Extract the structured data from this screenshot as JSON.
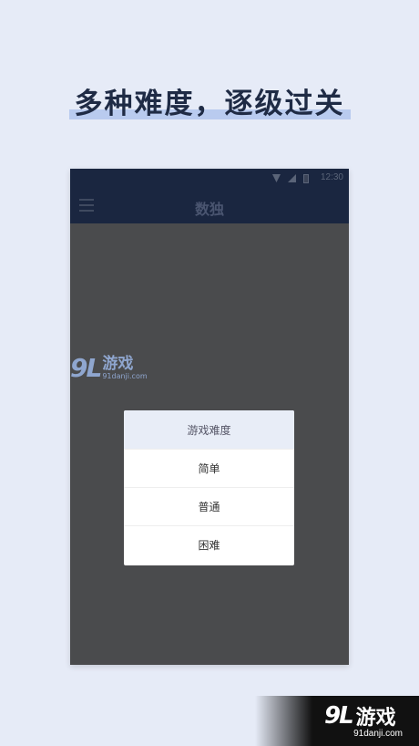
{
  "headline": "多种难度，逐级过关",
  "status_bar": {
    "time": "12:30"
  },
  "app_bar": {
    "title": "数独"
  },
  "dialog": {
    "title": "游戏难度",
    "options": [
      "简单",
      "普通",
      "困难"
    ]
  },
  "watermark": {
    "mark": "9L",
    "name": "游戏",
    "url": "91danji.com"
  },
  "corner_badge": {
    "mark": "9L",
    "name": "游戏",
    "url": "91danji.com"
  },
  "colors": {
    "background": "#e6ebf7",
    "headline_text": "#1f2b45",
    "headline_highlight": "#b9cbef",
    "app_bar": "#1a2640",
    "overlay": "#4a4b4d",
    "dialog_title_bg": "#e8edf7"
  },
  "icons": [
    "menu-icon",
    "wifi-icon",
    "signal-icon",
    "battery-icon"
  ]
}
